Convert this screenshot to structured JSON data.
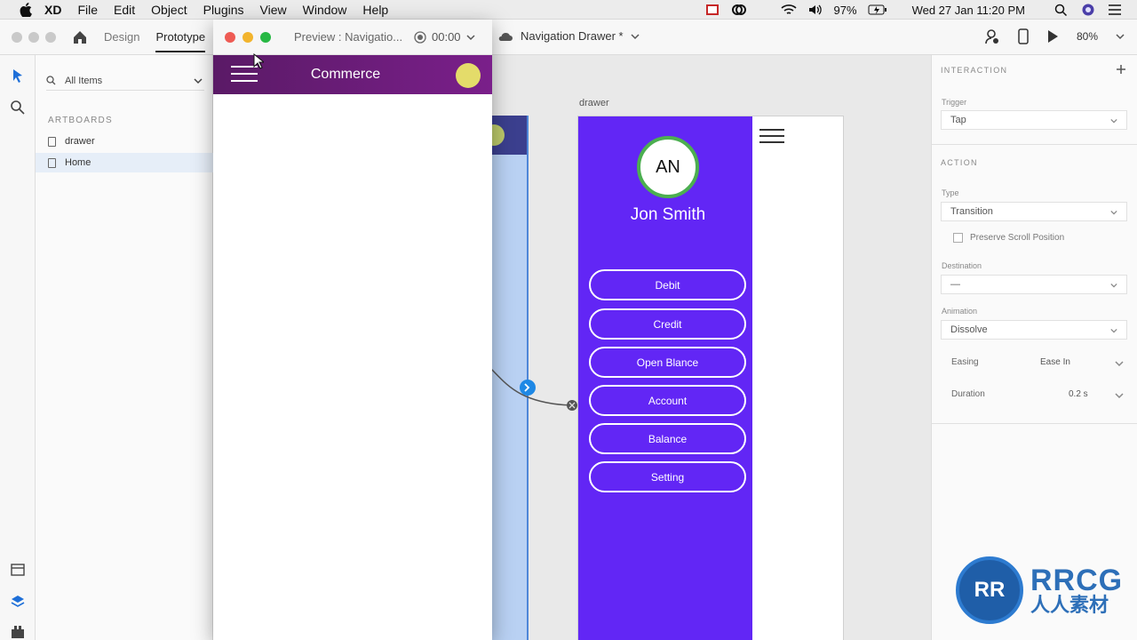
{
  "menubar": {
    "app": "XD",
    "items": [
      "File",
      "Edit",
      "Object",
      "Plugins",
      "View",
      "Window",
      "Help"
    ],
    "battery": "97%",
    "datetime": "Wed 27 Jan  11:20 PM"
  },
  "xd_toolbar": {
    "tabs": [
      "Design",
      "Prototype"
    ],
    "active_tab": "Prototype",
    "doc_title": "Navigation Drawer *",
    "zoom": "80%"
  },
  "preview": {
    "title": "Preview : Navigatio...",
    "timer": "00:00",
    "app_title": "Commerce"
  },
  "layers": {
    "search_placeholder": "All Items",
    "section": "ARTBOARDS",
    "artboards": [
      {
        "name": "drawer",
        "selected": false
      },
      {
        "name": "Home",
        "selected": true
      }
    ]
  },
  "canvas": {
    "drawer_label": "drawer",
    "avatar_initials": "AN",
    "user_name": "Jon Smith",
    "menu_buttons": [
      "Debit",
      "Credit",
      "Open Blance",
      "Account",
      "Balance",
      "Setting"
    ]
  },
  "properties": {
    "interaction_title": "INTERACTION",
    "trigger_label": "Trigger",
    "trigger_value": "Tap",
    "action_title": "ACTION",
    "type_label": "Type",
    "type_value": "Transition",
    "preserve_scroll": "Preserve Scroll Position",
    "destination_label": "Destination",
    "destination_value": "—",
    "animation_label": "Animation",
    "animation_value": "Dissolve",
    "easing_label": "Easing",
    "easing_value": "Ease In",
    "duration_label": "Duration",
    "duration_value": "0.2 s"
  },
  "watermark": {
    "brand": "RRCG",
    "subtitle": "人人素材"
  },
  "colors": {
    "drawer_purple": "#6226f5",
    "header_purple": "#6a1c79",
    "avatar_ring": "#4caf50",
    "link_blue": "#1e88e5"
  }
}
